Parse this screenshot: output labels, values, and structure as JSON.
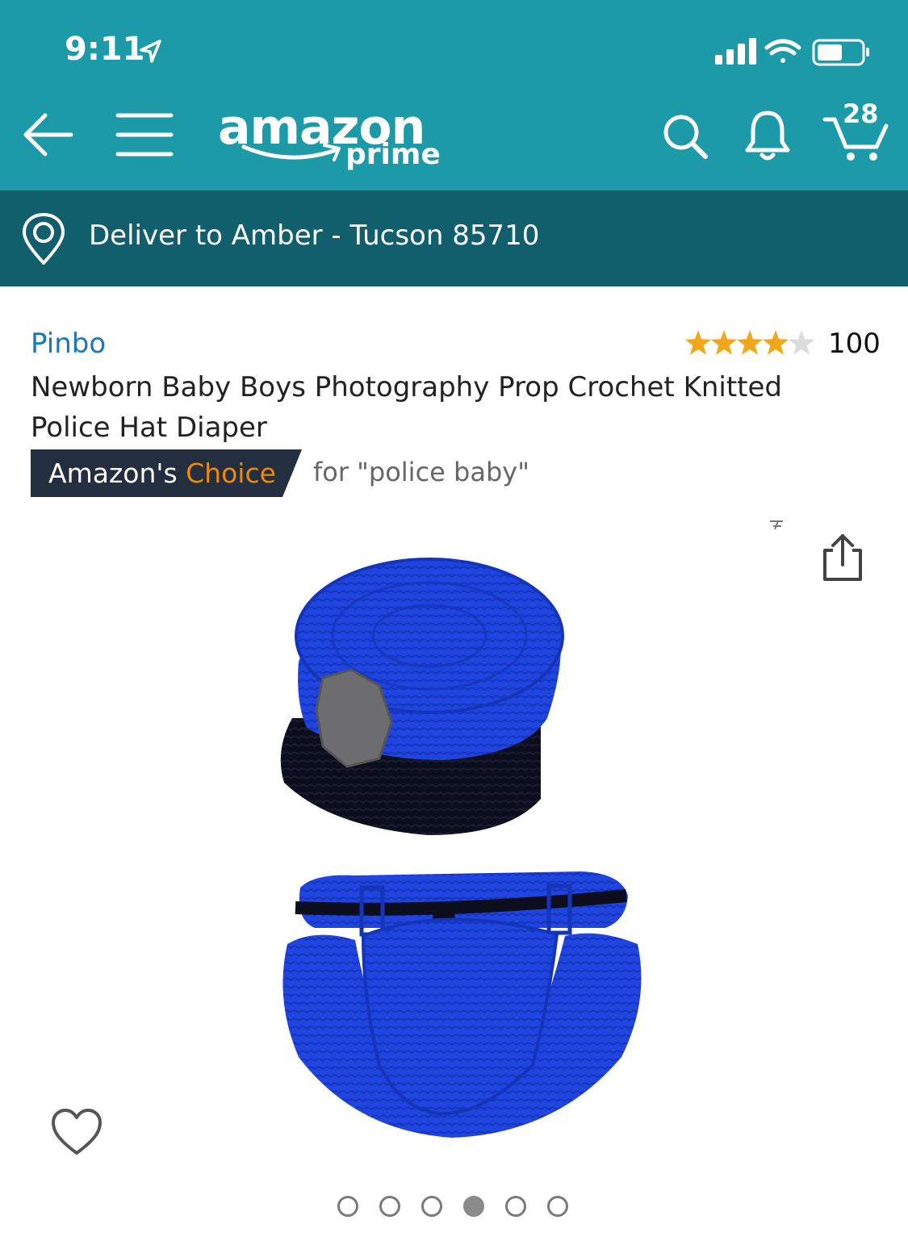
{
  "status_bar": {
    "time": "9:11"
  },
  "header": {
    "logo_word": "amazon",
    "logo_sub": "prime",
    "cart_count": "28"
  },
  "delivery": {
    "text": "Deliver to Amber - Tucson 85710"
  },
  "product": {
    "brand": "Pinbo",
    "rating": 4,
    "rating_max": 5,
    "rating_count": "100",
    "title": "Newborn Baby Boys Photography Prop Crochet Knitted Police Hat Diaper",
    "badge_prefix": "Amazon's",
    "badge_highlight": "Choice",
    "badge_query": "for \"police baby\""
  },
  "carousel": {
    "total": 6,
    "active_index": 3
  },
  "colors": {
    "header_teal": "#1c9aa7",
    "delivery_bar": "#115e6d",
    "brand_link": "#1b77b8",
    "badge_bg": "#232f3e",
    "badge_accent": "#f08804",
    "star": "#f0a81a",
    "crochet_blue": "#1f44e0"
  },
  "icons": [
    "back-arrow-icon",
    "menu-icon",
    "search-icon",
    "bell-icon",
    "cart-icon",
    "location-pin-icon",
    "share-icon",
    "heart-icon"
  ]
}
